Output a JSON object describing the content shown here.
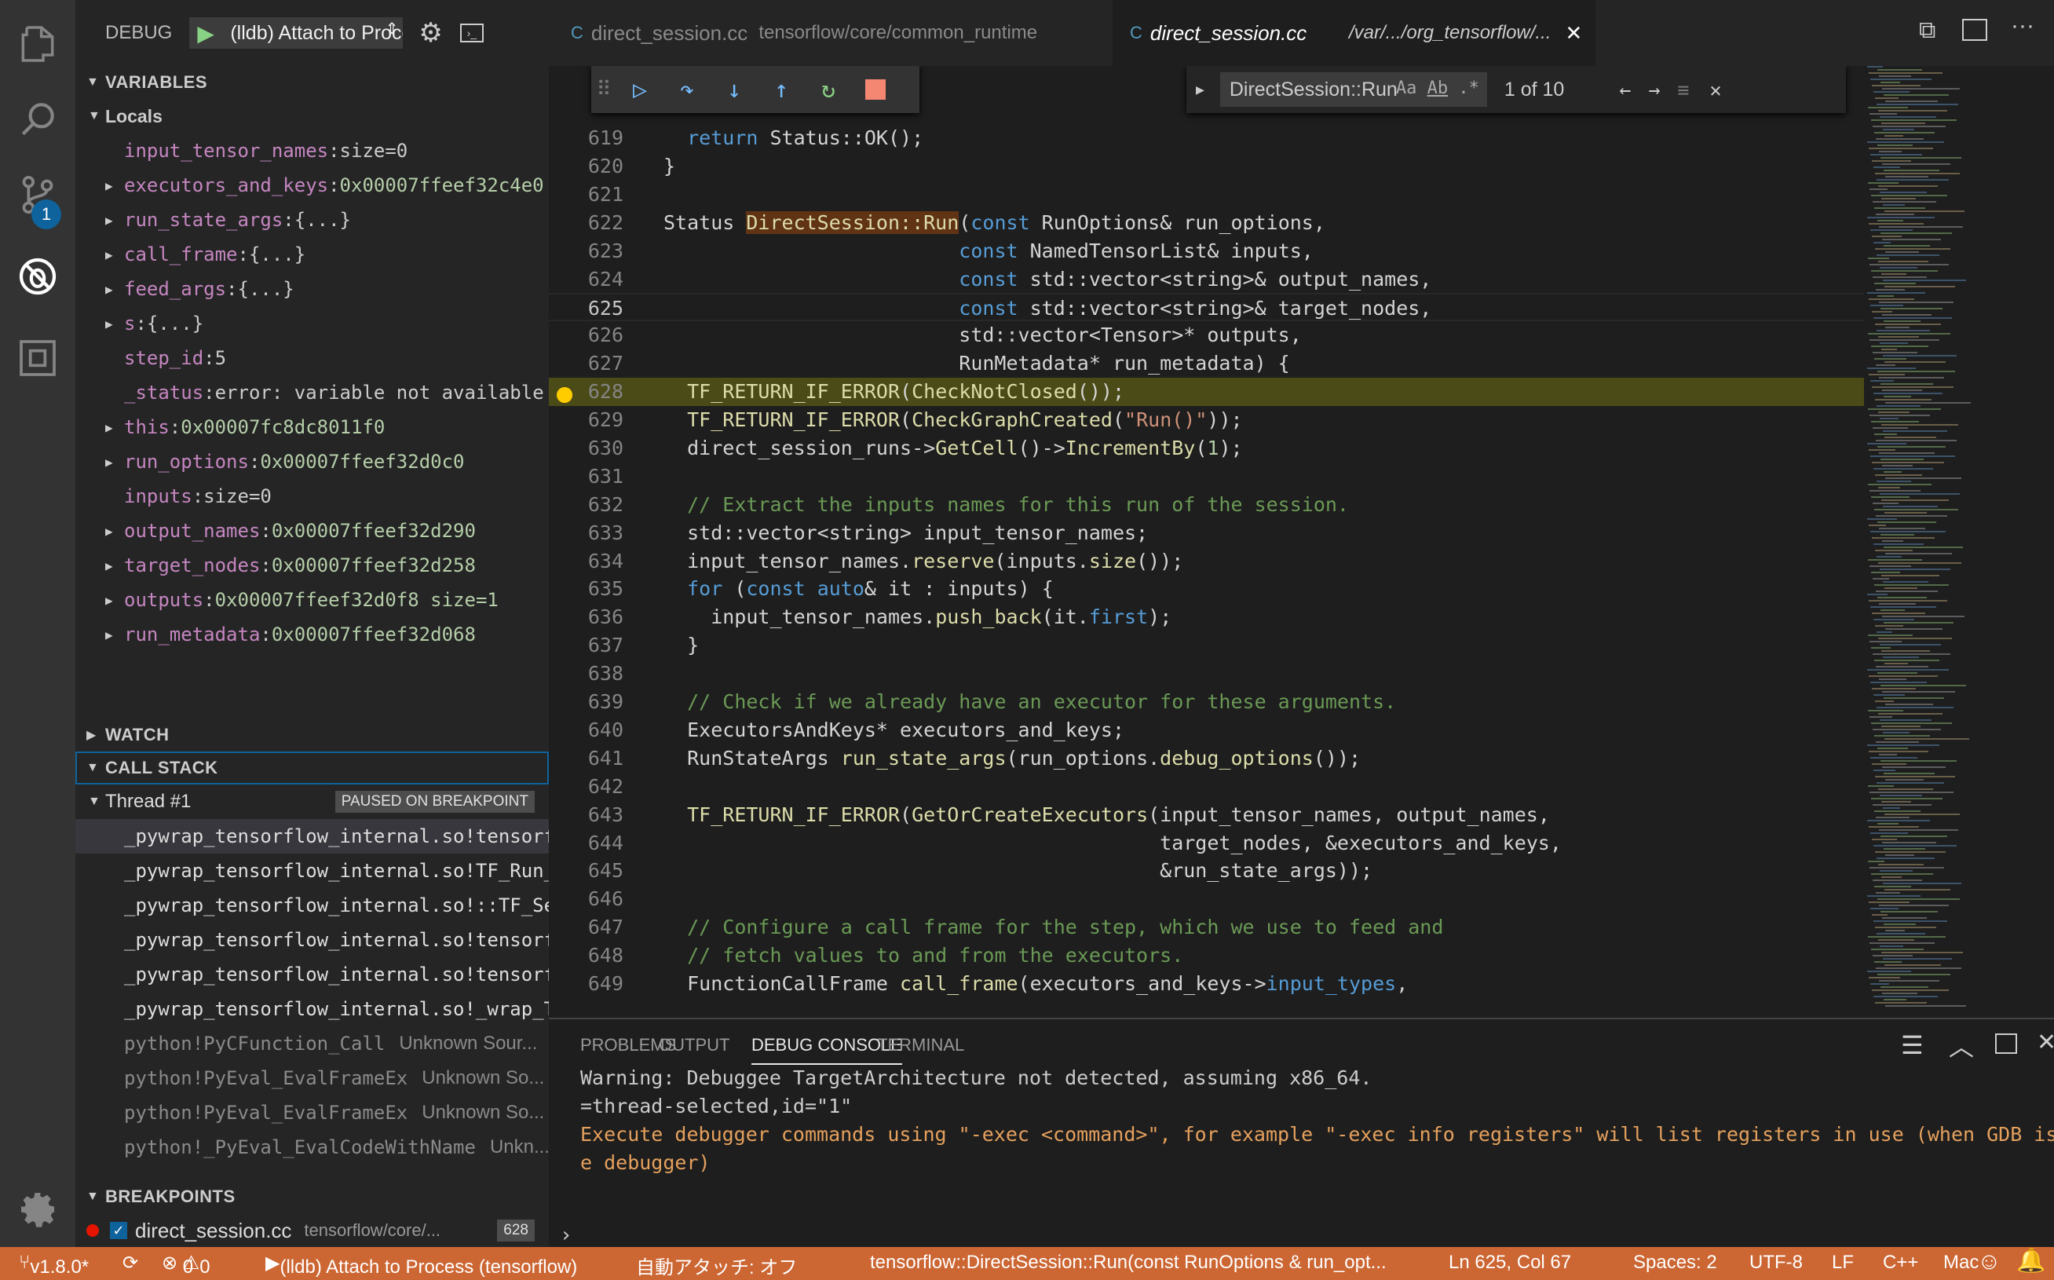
{
  "debug": {
    "label": "DEBUG",
    "config": "(lldb) Attach to Process"
  },
  "variables": {
    "title": "VARIABLES",
    "locals": "Locals",
    "items": [
      {
        "name": "input_tensor_names",
        "value": "size=0",
        "expandable": false
      },
      {
        "name": "executors_and_keys",
        "value": "0x00007ffeef32c4e0",
        "expandable": true
      },
      {
        "name": "run_state_args",
        "value": "{...}",
        "expandable": true
      },
      {
        "name": "call_frame",
        "value": "{...}",
        "expandable": true
      },
      {
        "name": "feed_args",
        "value": "{...}",
        "expandable": true
      },
      {
        "name": "s",
        "value": "{...}",
        "expandable": true
      },
      {
        "name": "step_id",
        "value": "5",
        "expandable": false
      },
      {
        "name": "_status",
        "value": "error: variable not available",
        "expandable": false
      },
      {
        "name": "this",
        "value": "0x00007fc8dc8011f0",
        "expandable": true
      },
      {
        "name": "run_options",
        "value": "0x00007ffeef32d0c0",
        "expandable": true
      },
      {
        "name": "inputs",
        "value": "size=0",
        "expandable": false
      },
      {
        "name": "output_names",
        "value": "0x00007ffeef32d290",
        "expandable": true
      },
      {
        "name": "target_nodes",
        "value": "0x00007ffeef32d258",
        "expandable": true
      },
      {
        "name": "outputs",
        "value": "0x00007ffeef32d0f8 size=1",
        "expandable": true
      },
      {
        "name": "run_metadata",
        "value": "0x00007ffeef32d068",
        "expandable": true
      }
    ]
  },
  "watch": {
    "title": "WATCH"
  },
  "callstack": {
    "title": "CALL STACK",
    "thread": "Thread #1",
    "status": "PAUSED ON BREAKPOINT",
    "frames": [
      {
        "fn": "_pywrap_tensorflow_internal.so!tensorflow::DirectSession::Run",
        "src": "",
        "gray": false
      },
      {
        "fn": "_pywrap_tensorflow_internal.so!TF_Run_Helper",
        "src": "",
        "gray": false
      },
      {
        "fn": "_pywrap_tensorflow_internal.so!::TF_SessionRun",
        "src": "",
        "gray": false
      },
      {
        "fn": "_pywrap_tensorflow_internal.so!tensorflow::TF_SessionRun_wrapper",
        "src": "",
        "gray": false
      },
      {
        "fn": "_pywrap_tensorflow_internal.so!tensorflow::TF_SessionRun_wrapper",
        "src": "",
        "gray": false
      },
      {
        "fn": "_pywrap_tensorflow_internal.so!_wrap_TF_SessionRun",
        "src": "",
        "gray": false
      },
      {
        "fn": "python!PyCFunction_Call",
        "src": "Unknown Sour...",
        "gray": true
      },
      {
        "fn": "python!PyEval_EvalFrameEx",
        "src": "Unknown So...",
        "gray": true
      },
      {
        "fn": "python!PyEval_EvalFrameEx",
        "src": "Unknown So...",
        "gray": true
      },
      {
        "fn": "python!_PyEval_EvalCodeWithName",
        "src": "Unkn...",
        "gray": true
      }
    ]
  },
  "breakpoints": {
    "title": "BREAKPOINTS",
    "file": "direct_session.cc",
    "path": "tensorflow/core/...",
    "line": "628"
  },
  "tabs": [
    {
      "name": "direct_session.cc",
      "desc": "tensorflow/core/common_runtime",
      "active": false
    },
    {
      "name": "direct_session.cc",
      "desc": "/var/.../org_tensorflow/...",
      "active": true
    }
  ],
  "find": {
    "query": "DirectSession::Run",
    "count": "1 of 10"
  },
  "editor": {
    "lines": [
      {
        "n": "619",
        "html": "  <span class='kw'>return</span> Status::OK();"
      },
      {
        "n": "620",
        "html": "}"
      },
      {
        "n": "621",
        "html": ""
      },
      {
        "n": "622",
        "html": "Status <span class='fn' style='background:#613315'>DirectSession::Run</span>(<span class='kw'>const</span> RunOptions& run_options,"
      },
      {
        "n": "623",
        "html": "                         <span class='kw'>const</span> NamedTensorList& inputs,"
      },
      {
        "n": "624",
        "html": "                         <span class='kw'>const</span> std::vector&lt;string&gt;& output_names,"
      },
      {
        "n": "625",
        "html": "                         <span class='kw'>const</span> std::vector&lt;string&gt;& target_nodes,",
        "cur": true
      },
      {
        "n": "626",
        "html": "                         std::vector&lt;Tensor&gt;* outputs,"
      },
      {
        "n": "627",
        "html": "                         RunMetadata* run_metadata) {"
      },
      {
        "n": "628",
        "html": "  <span class='fn'>TF_RETURN_IF_ERROR</span>(<span class='fn'>CheckNotClosed</span>());",
        "hl": true
      },
      {
        "n": "629",
        "html": "  <span class='fn'>TF_RETURN_IF_ERROR</span>(<span class='fn'>CheckGraphCreated</span>(<span class='st'>\"Run()\"</span>));"
      },
      {
        "n": "630",
        "html": "  direct_session_runs-&gt;<span class='fn'>GetCell</span>()-&gt;<span class='fn'>IncrementBy</span>(<span class='nu'>1</span>);"
      },
      {
        "n": "631",
        "html": ""
      },
      {
        "n": "632",
        "html": "  <span class='cm'>// Extract the inputs names for this run of the session.</span>"
      },
      {
        "n": "633",
        "html": "  std::vector&lt;string&gt; input_tensor_names;"
      },
      {
        "n": "634",
        "html": "  input_tensor_names.<span class='fn'>reserve</span>(inputs.<span class='fn'>size</span>());"
      },
      {
        "n": "635",
        "html": "  <span class='kw'>for</span> (<span class='kw'>const</span> <span class='kw'>auto</span>& it : inputs) {"
      },
      {
        "n": "636",
        "html": "    input_tensor_names.<span class='fn'>push_back</span>(it.<span class='kw'>first</span>);"
      },
      {
        "n": "637",
        "html": "  }"
      },
      {
        "n": "638",
        "html": ""
      },
      {
        "n": "639",
        "html": "  <span class='cm'>// Check if we already have an executor for these arguments.</span>"
      },
      {
        "n": "640",
        "html": "  ExecutorsAndKeys* executors_and_keys;"
      },
      {
        "n": "641",
        "html": "  RunStateArgs <span class='fn'>run_state_args</span>(run_options.<span class='fn'>debug_options</span>());"
      },
      {
        "n": "642",
        "html": ""
      },
      {
        "n": "643",
        "html": "  <span class='fn'>TF_RETURN_IF_ERROR</span>(<span class='fn'>GetOrCreateExecutors</span>(input_tensor_names, output_names,"
      },
      {
        "n": "644",
        "html": "                                          target_nodes, &executors_and_keys,"
      },
      {
        "n": "645",
        "html": "                                          &run_state_args));"
      },
      {
        "n": "646",
        "html": ""
      },
      {
        "n": "647",
        "html": "  <span class='cm'>// Configure a call frame for the step, which we use to feed and</span>"
      },
      {
        "n": "648",
        "html": "  <span class='cm'>// fetch values to and from the executors.</span>"
      },
      {
        "n": "649",
        "html": "  FunctionCallFrame <span class='fn'>call_frame</span>(executors_and_keys-&gt;<span class='kw'>input_types</span>,"
      }
    ]
  },
  "panel": {
    "tabs": [
      "PROBLEMS",
      "OUTPUT",
      "DEBUG CONSOLE",
      "TERMINAL"
    ],
    "active": 2,
    "lines": [
      {
        "text": "Warning: Debuggee TargetArchitecture not detected, assuming x86_64.",
        "color": "#cccccc"
      },
      {
        "text": "=thread-selected,id=\"1\"",
        "color": "#cccccc"
      },
      {
        "text": "Execute debugger commands using \"-exec <command>\", for example \"-exec info registers\" will list registers in use (when GDB is th",
        "color": "#e5a05d"
      },
      {
        "text": "e debugger)",
        "color": "#e5a05d"
      }
    ]
  },
  "status": {
    "branch": "v1.8.0*",
    "errors": "0",
    "warnings": "0",
    "process": "(lldb) Attach to Process (tensorflow)",
    "autoattach": "自動アタッチ: オフ",
    "func": "tensorflow::DirectSession::Run(const RunOptions & run_opt...",
    "position": "Ln 625, Col 67",
    "spaces": "Spaces: 2",
    "encoding": "UTF-8",
    "eol": "LF",
    "lang": "C++",
    "os": "Mac"
  },
  "colors": {
    "statusbar": "#cc6633",
    "highlight": "#4b4b18",
    "accent": "#0e639c"
  }
}
